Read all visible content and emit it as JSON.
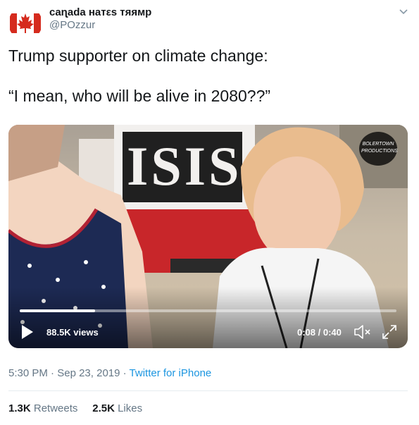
{
  "user": {
    "display_name": "cаɳаdа натεs тяᴙмр",
    "handle": "@POzzur"
  },
  "tweet": {
    "line1": "Trump supporter on climate change:",
    "line2": "“I mean, who will be alive in 2080??”"
  },
  "video": {
    "views": "88.5K views",
    "time": "0:08 / 0:40",
    "progress_fraction": 0.2,
    "sign_text": "ISIS",
    "watermark_text": "BOLERTOWN PRODUCTIONS"
  },
  "meta": {
    "time": "5:30 PM",
    "sep1": " · ",
    "date": "Sep 23, 2019",
    "sep2": " · ",
    "source": "Twitter for iPhone"
  },
  "stats": {
    "retweets_count": "1.3K",
    "retweets_label": "Retweets",
    "likes_count": "2.5K",
    "likes_label": "Likes"
  },
  "colors": {
    "link": "#1b95e0",
    "secondary_text": "#657786",
    "primary_text": "#14171a"
  }
}
